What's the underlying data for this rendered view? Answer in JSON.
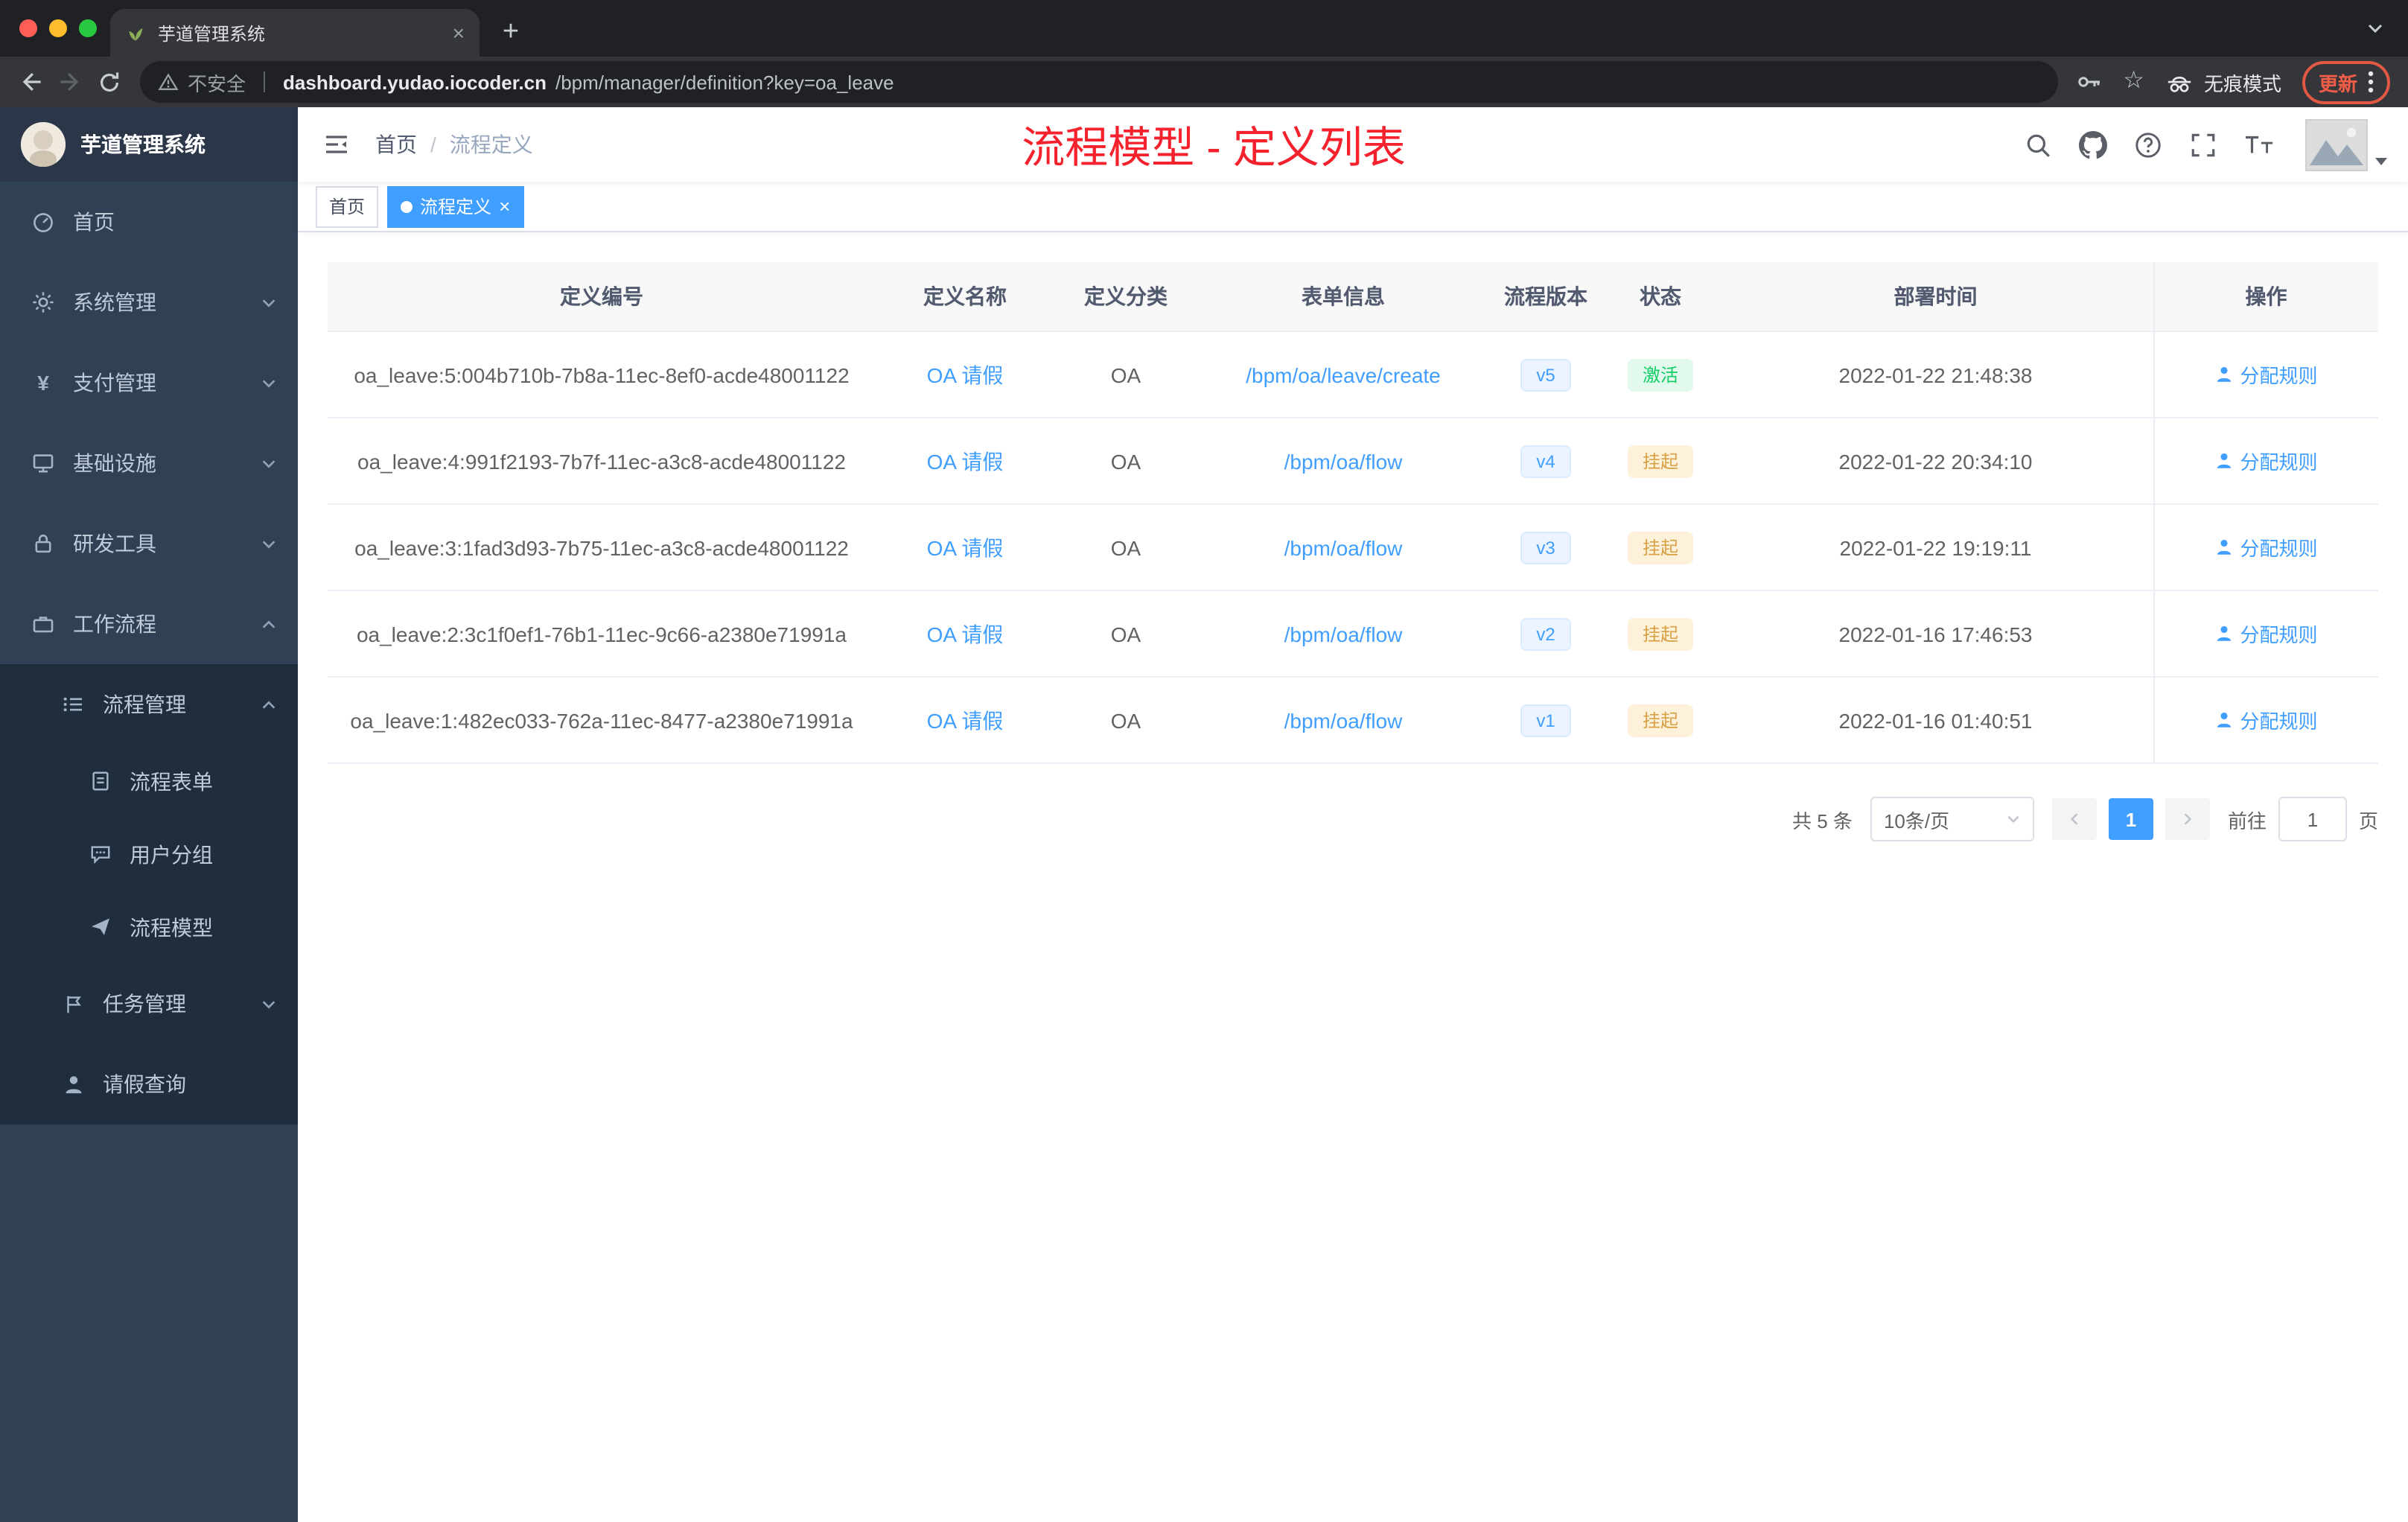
{
  "browser": {
    "tab_title": "芋道管理系统",
    "security_label": "不安全",
    "url_domain": "dashboard.yudao.iocoder.cn",
    "url_path": "/bpm/manager/definition?key=oa_leave",
    "incognito_label": "无痕模式",
    "update_label": "更新"
  },
  "sidebar": {
    "logo_title": "芋道管理系统",
    "items": [
      {
        "label": "首页"
      },
      {
        "label": "系统管理"
      },
      {
        "label": "支付管理"
      },
      {
        "label": "基础设施"
      },
      {
        "label": "研发工具"
      },
      {
        "label": "工作流程"
      },
      {
        "label": "流程管理"
      },
      {
        "label": "流程表单"
      },
      {
        "label": "用户分组"
      },
      {
        "label": "流程模型"
      },
      {
        "label": "任务管理"
      },
      {
        "label": "请假查询"
      }
    ]
  },
  "header": {
    "breadcrumb": {
      "home": "首页",
      "separator": "/",
      "current": "流程定义"
    },
    "annotation": "流程模型 - 定义列表"
  },
  "tags": {
    "home": "首页",
    "active": "流程定义"
  },
  "table": {
    "headers": [
      "定义编号",
      "定义名称",
      "定义分类",
      "表单信息",
      "流程版本",
      "状态",
      "部署时间",
      "操作"
    ],
    "rows": [
      {
        "id": "oa_leave:5:004b710b-7b8a-11ec-8ef0-acde48001122",
        "name": "OA 请假",
        "category": "OA",
        "form": "/bpm/oa/leave/create",
        "version": "v5",
        "status": "激活",
        "status_type": "success",
        "deploy_time": "2022-01-22 21:48:38",
        "action": "分配规则"
      },
      {
        "id": "oa_leave:4:991f2193-7b7f-11ec-a3c8-acde48001122",
        "name": "OA 请假",
        "category": "OA",
        "form": "/bpm/oa/flow",
        "version": "v4",
        "status": "挂起",
        "status_type": "warning",
        "deploy_time": "2022-01-22 20:34:10",
        "action": "分配规则"
      },
      {
        "id": "oa_leave:3:1fad3d93-7b75-11ec-a3c8-acde48001122",
        "name": "OA 请假",
        "category": "OA",
        "form": "/bpm/oa/flow",
        "version": "v3",
        "status": "挂起",
        "status_type": "warning",
        "deploy_time": "2022-01-22 19:19:11",
        "action": "分配规则"
      },
      {
        "id": "oa_leave:2:3c1f0ef1-76b1-11ec-9c66-a2380e71991a",
        "name": "OA 请假",
        "category": "OA",
        "form": "/bpm/oa/flow",
        "version": "v2",
        "status": "挂起",
        "status_type": "warning",
        "deploy_time": "2022-01-16 17:46:53",
        "action": "分配规则"
      },
      {
        "id": "oa_leave:1:482ec033-762a-11ec-8477-a2380e71991a",
        "name": "OA 请假",
        "category": "OA",
        "form": "/bpm/oa/flow",
        "version": "v1",
        "status": "挂起",
        "status_type": "warning",
        "deploy_time": "2022-01-16 01:40:51",
        "action": "分配规则"
      }
    ]
  },
  "pagination": {
    "total": "共 5 条",
    "page_size": "10条/页",
    "current": "1",
    "goto_prefix": "前往",
    "goto_value": "1",
    "goto_suffix": "页"
  },
  "colors": {
    "accent": "#409eff",
    "annotation_red": "#f5222d",
    "status_active_green": "#13ce66",
    "status_suspend_orange": "#e6a23c",
    "sidebar_bg": "#304156",
    "sidebar_submenu_bg": "#1f2d3d"
  }
}
